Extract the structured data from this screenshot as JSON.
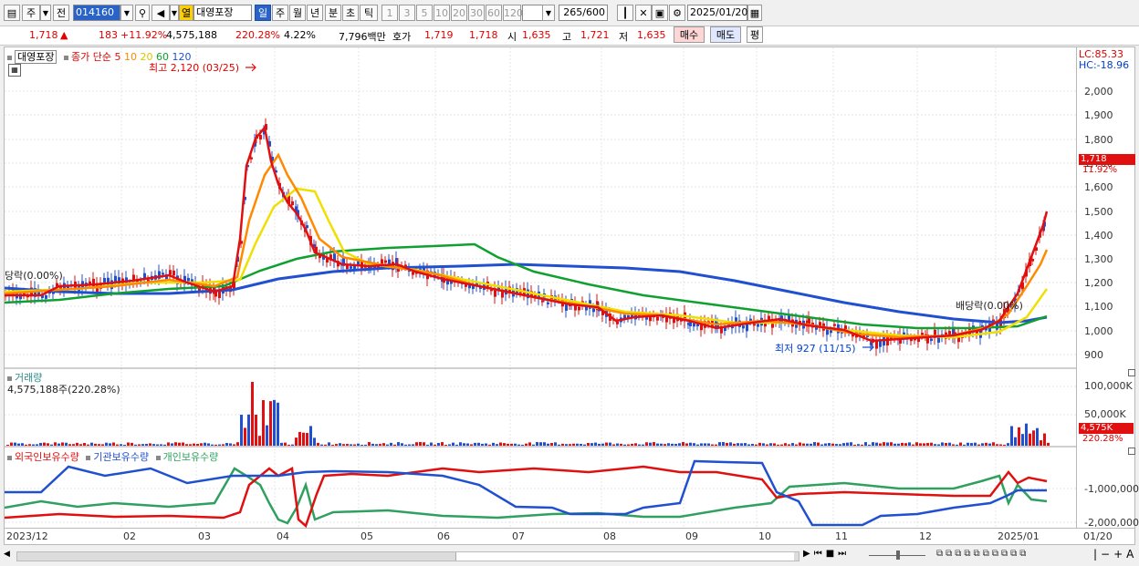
{
  "toolbar": {
    "period_day": "주",
    "prev_label": "전",
    "code": "014160",
    "stock_name": "대영포장",
    "ma_badge": "열",
    "periods": [
      "일",
      "주",
      "월",
      "년",
      "분",
      "초",
      "틱"
    ],
    "minutes": [
      "1",
      "3",
      "5",
      "10",
      "20",
      "30",
      "60",
      "120"
    ],
    "count": "265",
    "total": "/600",
    "date": "2025/01/20"
  },
  "quote": {
    "price": "1,718",
    "up_mark": "▲",
    "change": "183",
    "change_pct": "+11.92%",
    "volume": "4,575,188",
    "volume_pct": "220.28%",
    "turnover": "4.22%",
    "amount": "7,796백만",
    "ask_label": "호가",
    "ask": "1,719",
    "bid": "1,718",
    "open_label": "시",
    "open": "1,635",
    "high_label": "고",
    "high": "1,721",
    "low_label": "저",
    "low": "1,635",
    "buy": "매수",
    "sell": "매도",
    "flat": "평"
  },
  "price_panel": {
    "name": "대영포장",
    "ma_title": "종가 단순",
    "ma": [
      "5",
      "10",
      "20",
      "60",
      "120"
    ],
    "ma_colors": [
      "#e01010",
      "#ff8a00",
      "#f0e000",
      "#10a030",
      "#2050d0"
    ],
    "max_label": "최고 2,120 (03/25)",
    "min_label": "최저 927 (11/15)",
    "left_label": "당락(0.00%)",
    "div_label": "배당락(0.00%)",
    "lc": "LC:85.33",
    "hc": "HC:-18.96",
    "ticks": [
      "2,000",
      "1,900",
      "1,800",
      "1,700",
      "1,600",
      "1,500",
      "1,400",
      "1,300",
      "1,200",
      "1,100",
      "1,000",
      "900"
    ],
    "last_price": "1,718",
    "last_pct": "11.92%"
  },
  "volume_panel": {
    "title": "거래량",
    "value": "4,575,188주(220.28%)",
    "ticks": [
      "100,000K",
      "50,000K"
    ],
    "last": "4,575K",
    "last_pct": "220.28%"
  },
  "holding_panel": {
    "series": [
      "외국인보유수량",
      "기관보유수량",
      "개인보유수량"
    ],
    "colors": [
      "#e01010",
      "#2050d0",
      "#30a060"
    ],
    "ticks": [
      "-1,000,000",
      "-2,000,000"
    ]
  },
  "x_labels": [
    "2023/12",
    "02",
    "03",
    "04",
    "05",
    "06",
    "07",
    "08",
    "09",
    "10",
    "11",
    "12",
    "2025/01",
    "01/20"
  ]
}
